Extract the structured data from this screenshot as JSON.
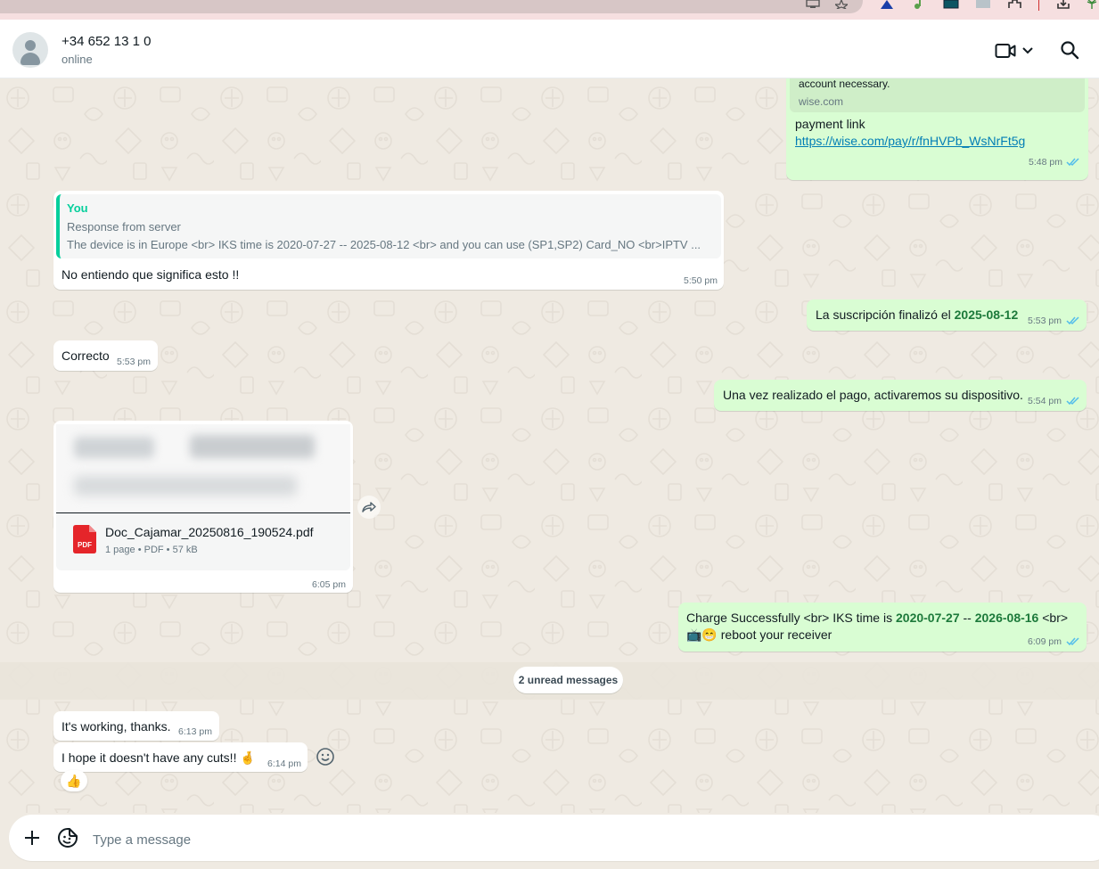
{
  "browser": {
    "extensions": [
      "monitor-icon",
      "star-icon",
      "extension-a-icon",
      "music-icon",
      "extension-square-icon",
      "extension-gray-icon",
      "puzzle-icon",
      "download-icon",
      "extension-palm-icon"
    ]
  },
  "header": {
    "contact_name": "+34 652 13 1  0",
    "status": "online"
  },
  "messages": {
    "wise": {
      "preview_description": "account necessary.",
      "preview_domain": "wise.com",
      "text": "payment link",
      "link": "https://wise.com/pay/r/fnHVPb_WsNrFt5g",
      "time": "5:48 pm"
    },
    "reply": {
      "quote_author": "You",
      "quote_line1": "Response from server",
      "quote_line2": "The device is in Europe <br> IKS time is 2020-07-27 -- 2025-08-12 <br> and you can use (SP1,SP2) Card_NO <br>IPTV ...",
      "text": "No entiendo que significa esto !!",
      "time": "5:50 pm"
    },
    "subscription": {
      "text_prefix": "La suscripción finalizó el",
      "date": "2025-08-12",
      "time": "5:53 pm"
    },
    "correcto": {
      "text": "Correcto",
      "time": "5:53 pm"
    },
    "payment_info": {
      "text": "Una vez realizado el pago, activaremos su dispositivo.",
      "time": "5:54 pm"
    },
    "document": {
      "file_name": "Doc_Cajamar_20250816_190524.pdf",
      "file_meta": "1 page • PDF • 57 kB",
      "file_type": "PDF",
      "time": "6:05 pm"
    },
    "charge": {
      "text1": "Charge Successfully <br> IKS time is",
      "date_start": "2020-07-27",
      "separator": "--",
      "date_end": "2026-08-16",
      "text2": "<br>",
      "emoji": "📺😁",
      "text3": "reboot your receiver",
      "time": "6:09 pm"
    },
    "unread_label": "2 unread messages",
    "working": {
      "text": "It's working, thanks.",
      "time": "6:13 pm"
    },
    "cuts": {
      "text": "I hope it doesn't have any cuts!!",
      "emoji": "🤞",
      "time": "6:14 pm",
      "reaction": "👍"
    }
  },
  "composer": {
    "placeholder": "Type a message"
  },
  "colors": {
    "outgoing_bubble": "#d9fdd3",
    "incoming_bubble": "#ffffff",
    "chat_background": "#efeae2",
    "read_ticks": "#53bdeb",
    "highlight_green": "#1d7a3b",
    "quote_bar": "#06cf9c",
    "pdf_red": "#e5252a"
  }
}
